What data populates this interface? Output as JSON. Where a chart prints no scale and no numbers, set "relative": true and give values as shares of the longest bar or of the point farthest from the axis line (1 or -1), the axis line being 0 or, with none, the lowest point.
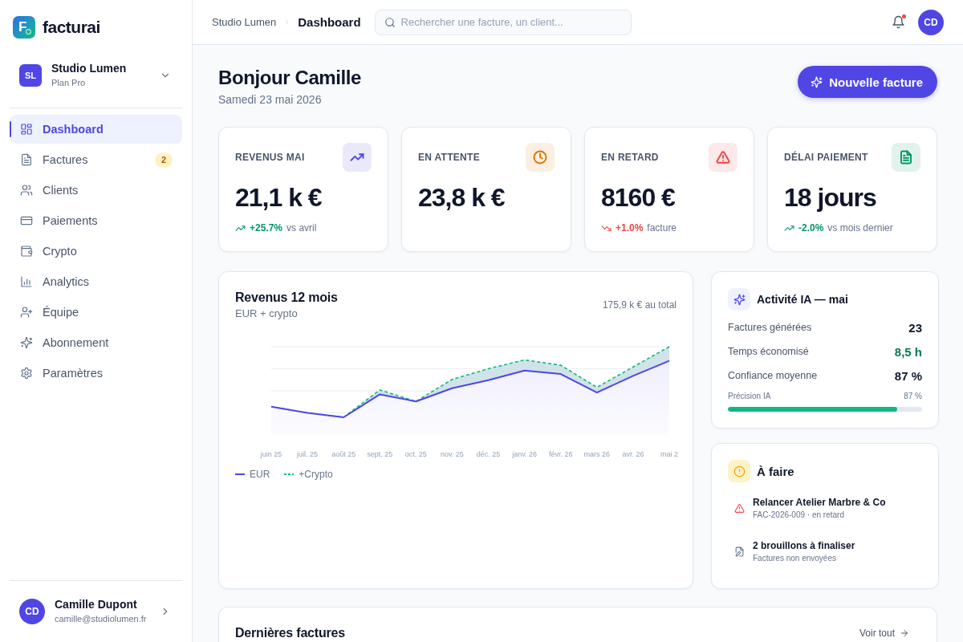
{
  "sidebar": {
    "logo": {
      "mark": "F",
      "name": "facturai"
    },
    "workspace": {
      "initials": "SL",
      "name": "Studio Lumen",
      "plan": "Plan Pro"
    },
    "nav": [
      {
        "label": "Dashboard",
        "selected": true
      },
      {
        "label": "Factures",
        "selected": false,
        "badge": "2"
      },
      {
        "label": "Clients",
        "selected": false
      },
      {
        "label": "Paiements",
        "selected": false
      },
      {
        "label": "Crypto",
        "selected": false
      },
      {
        "label": "Analytics",
        "selected": false
      },
      {
        "label": "Équipe",
        "selected": false
      },
      {
        "label": "Abonnement",
        "selected": false
      },
      {
        "label": "Paramètres",
        "selected": false
      }
    ],
    "user": {
      "initials": "CD",
      "name": "Camille Dupont",
      "email": "camille@studiolumen.fr"
    }
  },
  "header": {
    "breadcrumb": [
      {
        "label": "Studio Lumen"
      },
      {
        "label": "Dashboard"
      }
    ],
    "search": {
      "placeholder": "Rechercher une facture, un client..."
    },
    "notifications": {
      "unread": true
    },
    "avatar": "CD"
  },
  "greeting": {
    "title": "Bonjour Camille",
    "date": "Samedi 23 mai 2026",
    "button": "Nouvelle facture"
  },
  "kpis": [
    {
      "label": "REVENUS MAI",
      "value": "21,1 k €",
      "color": "#4f46e5",
      "delta": {
        "kind": "up",
        "color": "#059669",
        "value": "+25.7%",
        "text": "vs avril"
      }
    },
    {
      "label": "EN ATTENTE",
      "value": "23,8 k €",
      "color": "#d97706"
    },
    {
      "label": "EN RETARD",
      "value": "8160 €",
      "color": "#ef4444",
      "delta": {
        "kind": "down",
        "color": "#ef4444",
        "value": "+1.0%",
        "text": "facture"
      }
    },
    {
      "label": "DÉLAI PAIEMENT",
      "value": "18 jours",
      "color": "#059669",
      "delta": {
        "kind": "up",
        "color": "#059669",
        "value": "-2.0%",
        "text": "vs mois dernier"
      }
    }
  ],
  "revenue": {
    "subtitle": "EUR + crypto",
    "total": "175,9 k € au total",
    "chart_data": {
      "type": "area",
      "title": "Revenus 12 mois",
      "relative": true,
      "categories": [
        "juin 25",
        "juil. 25",
        "août 25",
        "sept. 25",
        "oct. 25",
        "nov. 25",
        "déc. 25",
        "janv. 26",
        "févr. 26",
        "mars 26",
        "avr. 26",
        "mai 2"
      ],
      "series": [
        {
          "name": "EUR",
          "color": "#4f46e5",
          "line_style": "solid",
          "values": [
            0.32,
            0.25,
            0.2,
            0.46,
            0.38,
            0.53,
            0.62,
            0.73,
            0.69,
            0.48,
            0.67,
            0.84
          ]
        },
        {
          "name": "+Crypto",
          "color": "#10b981",
          "line_style": "dashed",
          "values": [
            0.32,
            0.25,
            0.2,
            0.51,
            0.38,
            0.63,
            0.75,
            0.85,
            0.79,
            0.54,
            0.77,
            1.0
          ]
        }
      ]
    }
  },
  "ai_activity": {
    "title": "Activité IA — mai",
    "rows": [
      {
        "label": "Factures générées",
        "value": "23",
        "color": "#0f172a"
      },
      {
        "label": "Temps économisé",
        "value": "8,5 h",
        "color": "#047857"
      },
      {
        "label": "Confiance moyenne",
        "value": "87 %",
        "color": "#0f172a"
      }
    ],
    "precision": {
      "label": "Précision IA",
      "reading": "87 %",
      "level": 0.87
    }
  },
  "todo": {
    "title": "À faire",
    "items": [
      {
        "kind": "overdue",
        "title": "Relancer Atelier Marbre & Co",
        "subtitle": "FAC-2026-009 · en retard"
      },
      {
        "kind": "draft",
        "title": "2 brouillons à finaliser",
        "subtitle": "Factures non envoyées"
      }
    ]
  },
  "latest_invoices": {
    "title": "Dernières factures",
    "link": "Voir tout"
  }
}
